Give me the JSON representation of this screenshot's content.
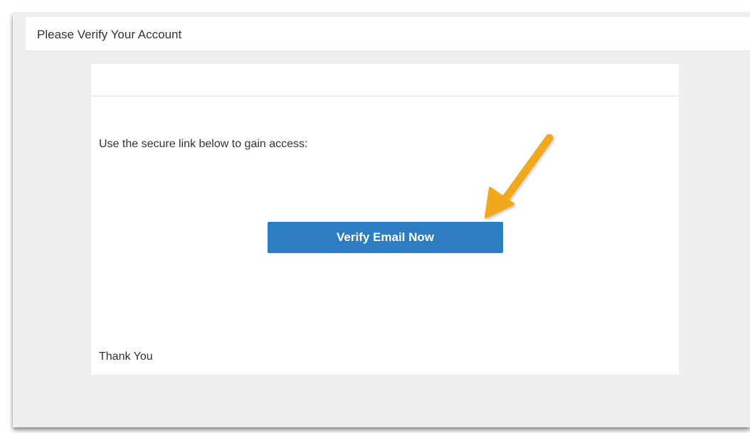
{
  "email": {
    "subject": "Please Verify Your Account",
    "intro": "Use the secure link below to gain access:",
    "button_label": "Verify Email Now",
    "signoff": "Thank You"
  },
  "annotation": {
    "pointer_icon": "arrow-pointer-icon",
    "color": "#f0a81c"
  },
  "colors": {
    "button": "#2d7dc3",
    "background": "#efefef"
  }
}
